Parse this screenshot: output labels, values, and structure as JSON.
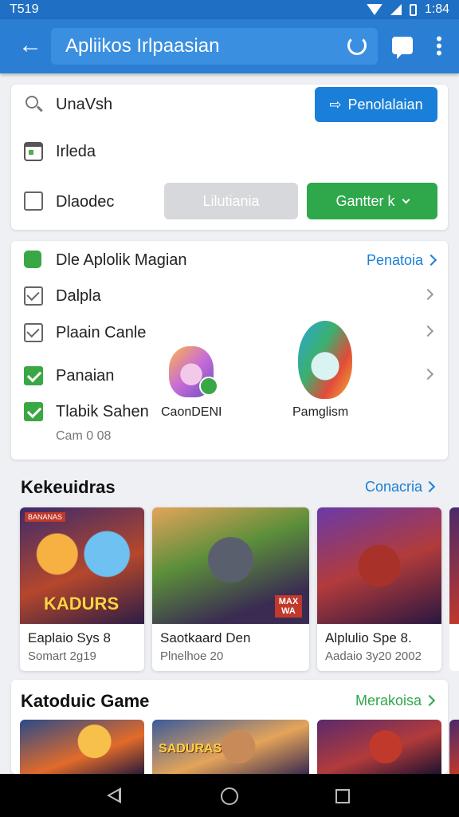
{
  "status_bar": {
    "time_left": "T519",
    "time_right": "1:84"
  },
  "app_bar": {
    "title": "Apliikos Irlpaasian"
  },
  "search_card": {
    "search_text": "UnaVsh",
    "search_button_label": "Penolalaian",
    "date_label": "Irleda",
    "checkbox_label": "Dlaodec",
    "grey_button_label": "Lilutiania",
    "green_button_label": "Gantter k"
  },
  "apps_card": {
    "header_title": "Dle Aplolik Magian",
    "header_link": "Penatoia",
    "items": [
      {
        "label": "Dalpla",
        "state": "checked-grey"
      },
      {
        "label": "Plaain Canle",
        "state": "checked-grey"
      },
      {
        "label": "Panaian",
        "state": "checked-green"
      },
      {
        "label": "Tlabik Sahen",
        "state": "checked-green"
      }
    ],
    "footnote": "Cam 0 08",
    "avatars": [
      {
        "name": "CaonDENI"
      },
      {
        "name": "Pamglism"
      }
    ]
  },
  "games_section": {
    "title": "Kekeuidras",
    "link": "Conacria",
    "cards": [
      {
        "name": "Eaplaio Sys 8",
        "sub": "Somart 2g19",
        "badge": "KADURS",
        "tag": "BANANAS"
      },
      {
        "name": "Saotkaard Den",
        "sub": "Plnelhoe  20",
        "badge": "MAX WA",
        "tag": ""
      },
      {
        "name": "Alplulio Spe 8.",
        "sub": "Aadaio 3y20 2002",
        "badge": "",
        "tag": ""
      }
    ]
  },
  "category_section": {
    "title": "Katoduic Game",
    "link": "Merakoisa",
    "cards": [
      {
        "badge": ""
      },
      {
        "badge": "SADURAS"
      },
      {
        "badge": ""
      }
    ]
  },
  "colors": {
    "primary": "#2a7fd4",
    "accent_green": "#2ea84a",
    "link_blue": "#1a7fd8",
    "link_green": "#2ea84a"
  }
}
